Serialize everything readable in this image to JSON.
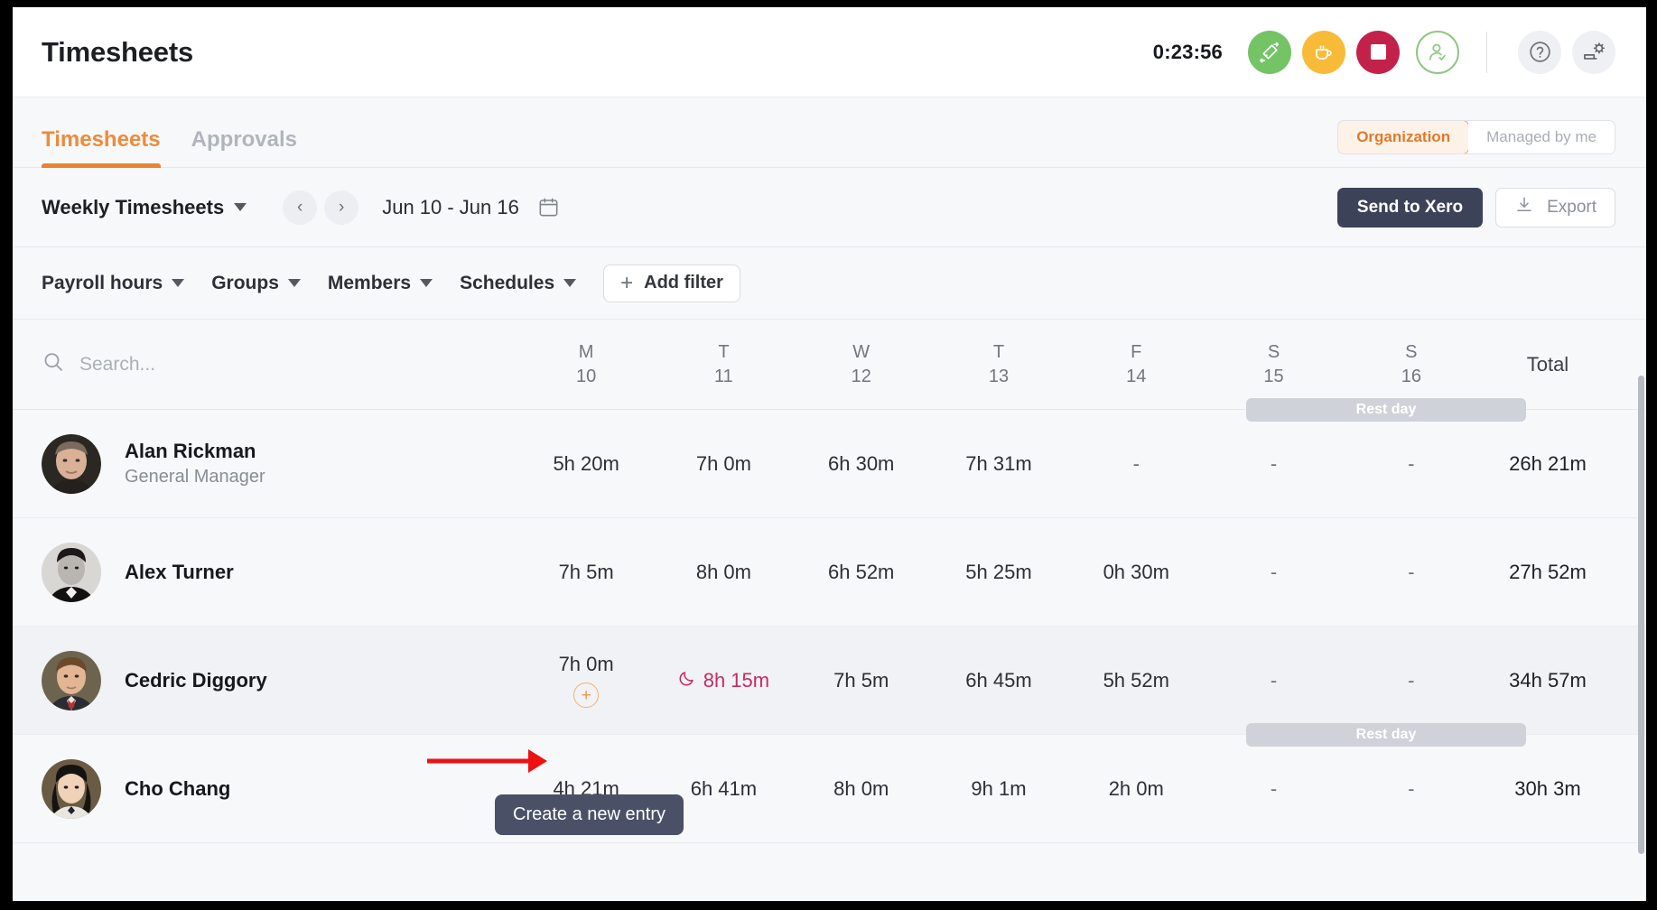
{
  "header": {
    "title": "Timesheets",
    "timer": "0:23:56",
    "icons": {
      "switch_task": "switch-task-icon",
      "break": "coffee-break-icon",
      "stop": "stop-icon",
      "user_status": "user-check-icon",
      "help": "help-icon",
      "settings": "settings-icon"
    }
  },
  "tabs": [
    {
      "label": "Timesheets",
      "active": true
    },
    {
      "label": "Approvals",
      "active": false
    }
  ],
  "scope_toggle": {
    "options": [
      {
        "label": "Organization",
        "active": true
      },
      {
        "label": "Managed by me",
        "active": false
      }
    ]
  },
  "controls": {
    "view_select": "Weekly Timesheets",
    "prev": "‹",
    "next": "›",
    "date_range": "Jun 10 - Jun 16",
    "calendar_icon": "calendar-icon",
    "send_to_xero": "Send to Xero",
    "export": "Export"
  },
  "filters": {
    "items": [
      "Payroll hours",
      "Groups",
      "Members",
      "Schedules"
    ],
    "add_filter": "Add filter"
  },
  "search": {
    "placeholder": "Search...",
    "value": ""
  },
  "table": {
    "day_columns": [
      {
        "dow": "M",
        "dom": "10"
      },
      {
        "dow": "T",
        "dom": "11"
      },
      {
        "dow": "W",
        "dom": "12"
      },
      {
        "dow": "T",
        "dom": "13"
      },
      {
        "dow": "F",
        "dom": "14"
      },
      {
        "dow": "S",
        "dom": "15"
      },
      {
        "dow": "S",
        "dom": "16"
      }
    ],
    "total_header": "Total",
    "rest_day_label": "Rest day",
    "rows": [
      {
        "name": "Alan Rickman",
        "role": "General Manager",
        "rest_day": true,
        "days": [
          "5h 20m",
          "7h 0m",
          "6h 30m",
          "7h 31m",
          "-",
          "-",
          "-"
        ],
        "total": "26h 21m"
      },
      {
        "name": "Alex Turner",
        "role": "",
        "rest_day": false,
        "days": [
          "7h 5m",
          "8h 0m",
          "6h 52m",
          "5h 25m",
          "0h 30m",
          "-",
          "-"
        ],
        "total": "27h 52m"
      },
      {
        "name": "Cedric Diggory",
        "role": "",
        "rest_day": false,
        "days": [
          "7h 0m",
          "8h 15m",
          "7h 5m",
          "6h 45m",
          "5h 52m",
          "-",
          "-"
        ],
        "night_day_index": 1,
        "add_entry_day_index": 0,
        "total": "34h 57m"
      },
      {
        "name": "Cho Chang",
        "role": "",
        "rest_day": true,
        "days": [
          "4h 21m",
          "6h 41m",
          "8h 0m",
          "9h 1m",
          "2h 0m",
          "-",
          "-"
        ],
        "total": "30h 3m"
      }
    ]
  },
  "tooltip": {
    "text": "Create a new entry"
  },
  "colors": {
    "accent_orange": "#ea8232",
    "dark_navy": "#3c4257",
    "tooltip_bg": "#4a5167",
    "night_crimson": "#c72a63",
    "green": "#74c365",
    "yellow": "#f7bb38",
    "red": "#c2224a",
    "annotation_red": "#ee1111"
  }
}
